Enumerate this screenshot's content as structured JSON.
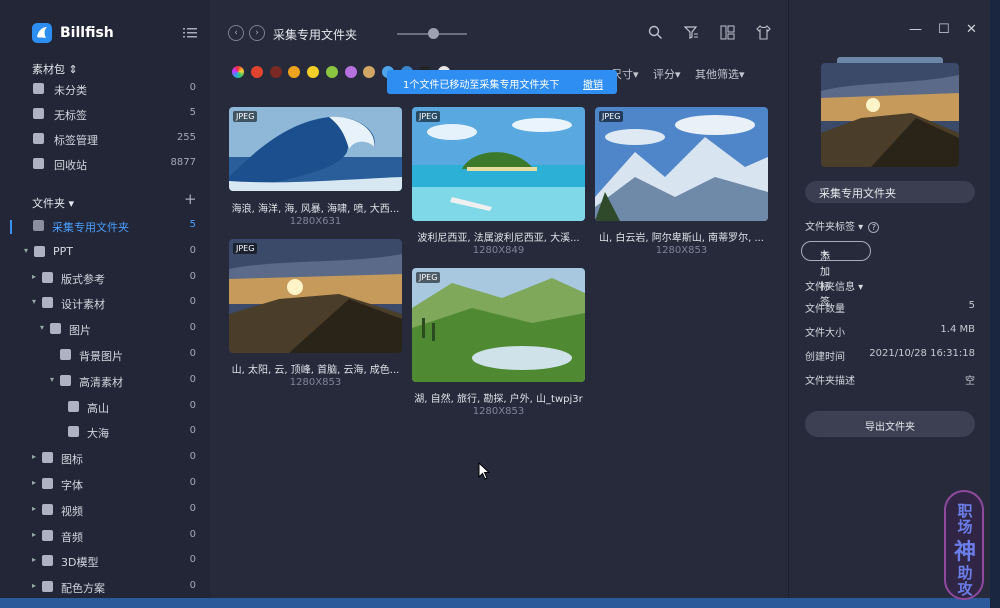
{
  "app": {
    "name": "Billfish"
  },
  "sidebar": {
    "library_label": "素材包",
    "library_items": [
      {
        "label": "未分类",
        "count": "0",
        "icon": "pie-icon"
      },
      {
        "label": "无标签",
        "count": "5",
        "icon": "tag-off-icon"
      },
      {
        "label": "标签管理",
        "count": "255",
        "icon": "tag-icon"
      },
      {
        "label": "回收站",
        "count": "8877",
        "icon": "trash-icon"
      }
    ],
    "folder_label": "文件夹",
    "folders": [
      {
        "label": "采集专用文件夹",
        "count": "5",
        "level": 0,
        "arrow": "",
        "active": true
      },
      {
        "label": "PPT",
        "count": "0",
        "level": 0,
        "arrow": "▾"
      },
      {
        "label": "版式参考",
        "count": "0",
        "level": 1,
        "arrow": "▸"
      },
      {
        "label": "设计素材",
        "count": "0",
        "level": 1,
        "arrow": "▾"
      },
      {
        "label": "图片",
        "count": "0",
        "level": 2,
        "arrow": "▾"
      },
      {
        "label": "背景图片",
        "count": "0",
        "level": 3,
        "arrow": ""
      },
      {
        "label": "高清素材",
        "count": "0",
        "level": 3,
        "arrow": "▾"
      },
      {
        "label": "高山",
        "count": "0",
        "level": 4,
        "arrow": ""
      },
      {
        "label": "大海",
        "count": "0",
        "level": 4,
        "arrow": ""
      },
      {
        "label": "图标",
        "count": "0",
        "level": 1,
        "arrow": "▸"
      },
      {
        "label": "字体",
        "count": "0",
        "level": 1,
        "arrow": "▸"
      },
      {
        "label": "视频",
        "count": "0",
        "level": 1,
        "arrow": "▸"
      },
      {
        "label": "音频",
        "count": "0",
        "level": 1,
        "arrow": "▸"
      },
      {
        "label": "3D模型",
        "count": "0",
        "level": 1,
        "arrow": "▸"
      },
      {
        "label": "配色方案",
        "count": "0",
        "level": 1,
        "arrow": "▸"
      }
    ]
  },
  "toolbar": {
    "folder_title": "采集专用文件夹",
    "filter_size": "尺寸",
    "filter_rating": "评分",
    "filter_other": "其他筛选"
  },
  "colors": [
    "#e0442e",
    "#7a2a25",
    "#f0a21f",
    "#f3cf2a",
    "#8bc43f",
    "#b872e0",
    "#d0a565",
    "#4fa3e8",
    "#3a87d0",
    "#222222",
    "#e8e8e8"
  ],
  "toast": {
    "message": "1个文件已移动至采集专用文件夹下",
    "undo": "撤销"
  },
  "files": [
    {
      "name": "海浪, 海洋, 海, 风暴, 海啸, 喷, 大西...",
      "size": "1280X631",
      "type": "JPEG"
    },
    {
      "name": "波利尼西亚, 法属波利尼西亚, 大溪...",
      "size": "1280X849",
      "type": "JPEG"
    },
    {
      "name": "山, 白云岩, 阿尔卑斯山, 南蒂罗尔, ...",
      "size": "1280X853",
      "type": "JPEG"
    },
    {
      "name": "山, 太阳, 云, 顶峰, 首脑, 云海, 成色...",
      "size": "1280X853",
      "type": "JPEG"
    },
    {
      "name": "湖, 自然, 旅行, 勘探, 户外, 山_twpj3r",
      "size": "1280X853",
      "type": "JPEG"
    }
  ],
  "panel": {
    "folder_name": "采集专用文件夹",
    "tags_label": "文件夹标签",
    "add_tag": "添加标签",
    "info_label": "文件夹信息",
    "info": [
      {
        "label": "文件数量",
        "value": "5"
      },
      {
        "label": "文件大小",
        "value": "1.4 MB"
      },
      {
        "label": "创建时间",
        "value": "2021/10/28 16:31:18"
      },
      {
        "label": "文件夹描述",
        "value": "空"
      }
    ],
    "export": "导出文件夹"
  },
  "watermark": [
    "职",
    "场",
    "神",
    "助",
    "攻"
  ]
}
